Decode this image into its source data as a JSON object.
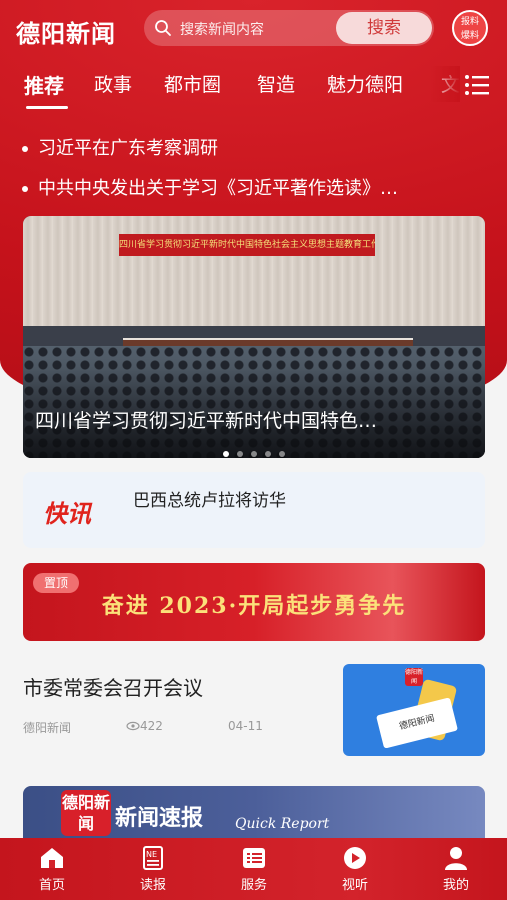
{
  "header": {
    "logo": "德阳新闻",
    "search_placeholder": "搜索新闻内容",
    "search_button": "搜索",
    "report_badge": [
      "报料",
      "爆料"
    ]
  },
  "tabs": [
    {
      "label": "推荐",
      "active": true
    },
    {
      "label": "政事",
      "active": false
    },
    {
      "label": "都市圈",
      "active": false
    },
    {
      "label": "智造",
      "active": false
    },
    {
      "label": "魅力德阳",
      "active": false
    },
    {
      "label": "文",
      "active": false
    }
  ],
  "headlines": [
    "习近平在广东考察调研",
    "中共中央发出关于学习《习近平著作选读》…"
  ],
  "carousel": {
    "banner_text": "四川省学习贯彻习近平新时代中国特色社会主义思想主题教育工作会议",
    "caption": "四川省学习贯彻习近平新时代中国特色…",
    "slide_count": 5,
    "active_slide": 0
  },
  "flash": {
    "logo": "快讯",
    "text": "巴西总统卢拉将访华"
  },
  "promo": {
    "badge": "置顶",
    "text": "奋进 2023·开局起步勇争先"
  },
  "news_item": {
    "title": "市委常委会召开会议",
    "source": "德阳新闻",
    "views": "422",
    "date": "04-11",
    "thumb_logo": "德阳新闻",
    "thumb_card": "德阳新闻"
  },
  "quick_report": {
    "logo": "德阳新闻",
    "title": "新闻速报",
    "subtitle": "Quick Report"
  },
  "bottom_nav": [
    {
      "label": "首页",
      "icon": "home-icon"
    },
    {
      "label": "读报",
      "icon": "newspaper-icon"
    },
    {
      "label": "服务",
      "icon": "service-icon"
    },
    {
      "label": "视听",
      "icon": "play-icon"
    },
    {
      "label": "我的",
      "icon": "user-icon"
    }
  ],
  "colors": {
    "brand_red": "#c5121b",
    "promo_gold": "#fbe17a"
  }
}
